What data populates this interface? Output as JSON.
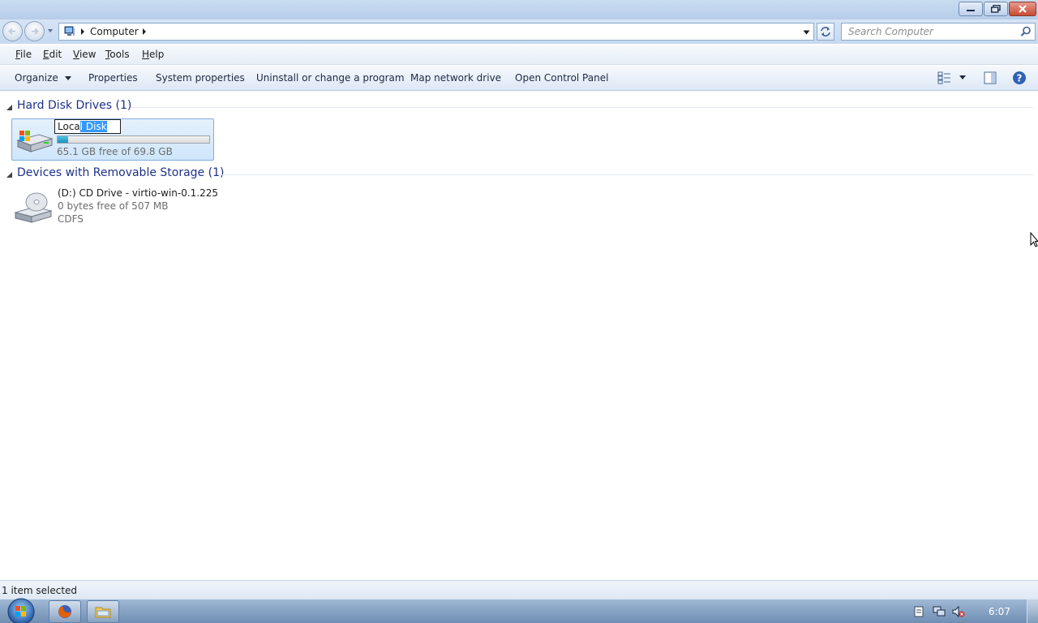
{
  "window": {
    "title": "",
    "controls": [
      "minimize",
      "maximize",
      "close"
    ]
  },
  "address": {
    "location": "Computer",
    "icon": "computer-icon"
  },
  "search": {
    "placeholder": "Search Computer"
  },
  "menu": {
    "items": [
      {
        "label": "File",
        "access_key": "F"
      },
      {
        "label": "Edit",
        "access_key": "E"
      },
      {
        "label": "View",
        "access_key": "V"
      },
      {
        "label": "Tools",
        "access_key": "T"
      },
      {
        "label": "Help",
        "access_key": "H"
      }
    ]
  },
  "commands": {
    "organize": "Organize",
    "properties": "Properties",
    "system_properties": "System properties",
    "uninstall": "Uninstall or change a program",
    "map_drive": "Map network drive",
    "control_panel": "Open Control Panel"
  },
  "groups": {
    "hard_disks": {
      "title": "Hard Disk Drives (1)",
      "drives": [
        {
          "name": "Local Disk",
          "rename_value_unselected": "Loca",
          "rename_value_selected": "l Disk",
          "free_text": "65.1 GB free of 69.8 GB",
          "used_fraction": 0.067,
          "icon": "windows-hard-drive-icon"
        }
      ]
    },
    "removable": {
      "title": "Devices with Removable Storage (1)",
      "drives": [
        {
          "name": "(D:) CD Drive - virtio-win-0.1.225",
          "free_text": "0 bytes free of 507 MB",
          "filesystem": "CDFS",
          "icon": "cd-drive-icon"
        }
      ]
    }
  },
  "status": {
    "text": "1 item selected"
  },
  "taskbar": {
    "clock": "6:07",
    "apps": [
      "firefox-icon",
      "windows-explorer-icon"
    ],
    "tray": [
      "action-center-icon",
      "network-icon",
      "volume-muted-icon"
    ]
  },
  "colors": {
    "group_title": "#1e3287",
    "selection": "#3399ff",
    "usage_fill": "#26a0d4"
  }
}
